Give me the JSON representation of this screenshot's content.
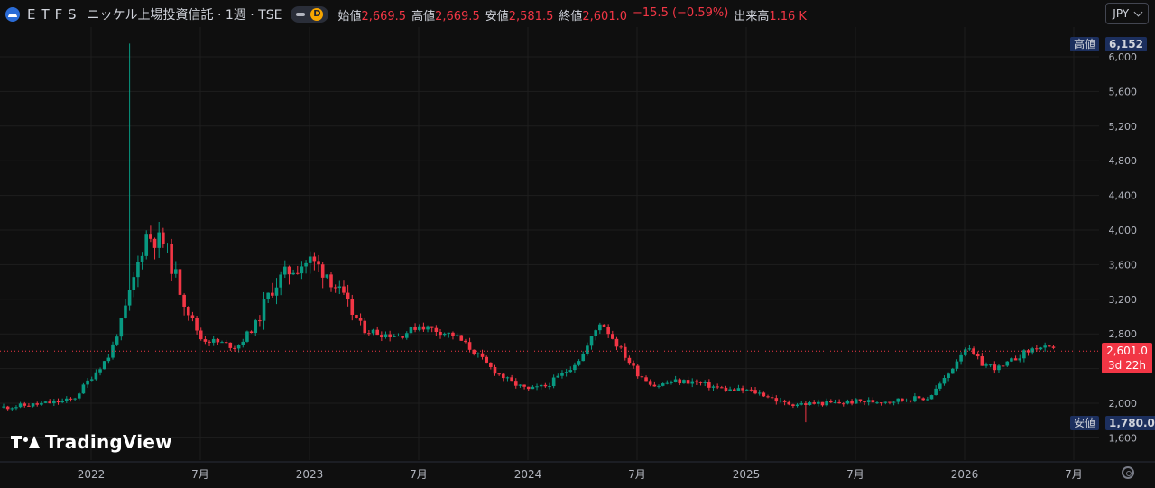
{
  "header": {
    "symbol": "ETFS",
    "title": "ニッケル上場投資信託 · 1週 · TSE",
    "pill_letter": "D",
    "ohlc": [
      {
        "label": "始値",
        "value": "2,669.5"
      },
      {
        "label": "高値",
        "value": "2,669.5"
      },
      {
        "label": "安値",
        "value": "2,581.5"
      },
      {
        "label": "終値",
        "value": "2,601.0"
      }
    ],
    "change": "−15.5 (−0.59%)",
    "volume_label": "出来高",
    "volume_value": "1.16 K"
  },
  "currency": "JPY",
  "tags": {
    "high_label": "高値",
    "high_value": "6,152",
    "low_label": "安値",
    "low_value": "1,780.0",
    "last_price": "2,601.0",
    "countdown": "3d 22h"
  },
  "brand": "TradingView",
  "colors": {
    "up": "#089981",
    "down": "#f23645",
    "bg": "#0f0f0f",
    "grid": "#1e1e1e",
    "text": "#b2b5be"
  },
  "chart_data": {
    "type": "candlestick",
    "title": "ニッケル上場投資信託",
    "interval": "1週",
    "exchange": "TSE",
    "currency": "JPY",
    "y_axis": {
      "range": [
        1400,
        6400
      ],
      "ticks": [
        1600,
        2000,
        2400,
        2800,
        3200,
        3600,
        4000,
        4400,
        4800,
        5200,
        5600,
        6000
      ],
      "tick_labels": [
        "1,600",
        "2,000",
        "",
        "2,800",
        "3,200",
        "3,600",
        "4,000",
        "4,400",
        "4,800",
        "5,200",
        "5,600",
        "6,000"
      ],
      "side": "right"
    },
    "x_axis": {
      "range": [
        "2021-08",
        "2026-09"
      ],
      "ticks": [
        "2022-01",
        "2022-07",
        "2023-01",
        "2023-07",
        "2024-01",
        "2024-07",
        "2025-01",
        "2025-07",
        "2026-01",
        "2026-07"
      ],
      "tick_labels": [
        "2022",
        "7月",
        "2023",
        "7月",
        "2024",
        "7月",
        "2025",
        "7月",
        "2026",
        "7月"
      ]
    },
    "grid": true,
    "last_price": 2601.0,
    "all_time_high": 6152,
    "period_low": 1780.0,
    "close_path": [
      [
        "2021-08",
        1950
      ],
      [
        "2021-10",
        1985
      ],
      [
        "2021-12",
        2040
      ],
      [
        "2022-01",
        2300
      ],
      [
        "2022-02",
        2550
      ],
      [
        "2022-03",
        3150
      ],
      [
        "2022-04",
        3950
      ],
      [
        "2022-05",
        3850
      ],
      [
        "2022-06",
        3250
      ],
      [
        "2022-07",
        2750
      ],
      [
        "2022-08",
        2700
      ],
      [
        "2022-09",
        2650
      ],
      [
        "2022-10",
        2900
      ],
      [
        "2022-11",
        3350
      ],
      [
        "2022-12",
        3550
      ],
      [
        "2023-01",
        3650
      ],
      [
        "2023-02",
        3500
      ],
      [
        "2023-03",
        3150
      ],
      [
        "2023-04",
        2850
      ],
      [
        "2023-05",
        2800
      ],
      [
        "2023-06",
        2780
      ],
      [
        "2023-07",
        2900
      ],
      [
        "2023-08",
        2840
      ],
      [
        "2023-09",
        2780
      ],
      [
        "2023-10",
        2600
      ],
      [
        "2023-11",
        2400
      ],
      [
        "2023-12",
        2250
      ],
      [
        "2024-01",
        2150
      ],
      [
        "2024-02",
        2200
      ],
      [
        "2024-03",
        2350
      ],
      [
        "2024-04",
        2550
      ],
      [
        "2024-05",
        2950
      ],
      [
        "2024-06",
        2650
      ],
      [
        "2024-07",
        2350
      ],
      [
        "2024-08",
        2200
      ],
      [
        "2024-09",
        2250
      ],
      [
        "2024-10",
        2250
      ],
      [
        "2024-11",
        2200
      ],
      [
        "2024-12",
        2150
      ],
      [
        "2025-01",
        2150
      ],
      [
        "2025-02",
        2100
      ],
      [
        "2025-03",
        2000
      ],
      [
        "2025-04",
        1990
      ],
      [
        "2025-05",
        2000
      ],
      [
        "2025-06",
        2000
      ],
      [
        "2025-07",
        2020
      ],
      [
        "2025-08",
        2020
      ],
      [
        "2025-09",
        2030
      ],
      [
        "2025-10",
        2050
      ],
      [
        "2025-11",
        2060
      ],
      [
        "2025-12",
        2300
      ],
      [
        "2026-01",
        2650
      ],
      [
        "2026-02",
        2450
      ],
      [
        "2026-03",
        2400
      ],
      [
        "2026-04",
        2550
      ],
      [
        "2026-05",
        2650
      ],
      [
        "2026-06",
        2601
      ]
    ]
  }
}
